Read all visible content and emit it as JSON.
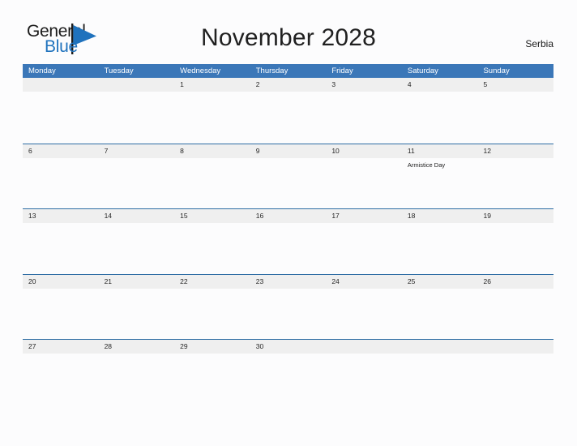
{
  "brand": {
    "name_part1": "General",
    "name_part2": "Blue",
    "flag_icon": "blue-triangle-flag-icon",
    "accent_color": "#1f72bd"
  },
  "header": {
    "title": "November 2028",
    "region": "Serbia"
  },
  "calendar": {
    "colors": {
      "header_blue": "#3b77b8",
      "row_rule_blue": "#2e6da4",
      "day_band_gray": "#efefef",
      "page_background": "#fcfcfd"
    },
    "weekdays": [
      "Monday",
      "Tuesday",
      "Wednesday",
      "Thursday",
      "Friday",
      "Saturday",
      "Sunday"
    ],
    "weeks": [
      {
        "days": [
          {
            "number": "",
            "events": []
          },
          {
            "number": "",
            "events": []
          },
          {
            "number": "1",
            "events": []
          },
          {
            "number": "2",
            "events": []
          },
          {
            "number": "3",
            "events": []
          },
          {
            "number": "4",
            "events": []
          },
          {
            "number": "5",
            "events": []
          }
        ]
      },
      {
        "days": [
          {
            "number": "6",
            "events": []
          },
          {
            "number": "7",
            "events": []
          },
          {
            "number": "8",
            "events": []
          },
          {
            "number": "9",
            "events": []
          },
          {
            "number": "10",
            "events": []
          },
          {
            "number": "11",
            "events": [
              "Armistice Day"
            ]
          },
          {
            "number": "12",
            "events": []
          }
        ]
      },
      {
        "days": [
          {
            "number": "13",
            "events": []
          },
          {
            "number": "14",
            "events": []
          },
          {
            "number": "15",
            "events": []
          },
          {
            "number": "16",
            "events": []
          },
          {
            "number": "17",
            "events": []
          },
          {
            "number": "18",
            "events": []
          },
          {
            "number": "19",
            "events": []
          }
        ]
      },
      {
        "days": [
          {
            "number": "20",
            "events": []
          },
          {
            "number": "21",
            "events": []
          },
          {
            "number": "22",
            "events": []
          },
          {
            "number": "23",
            "events": []
          },
          {
            "number": "24",
            "events": []
          },
          {
            "number": "25",
            "events": []
          },
          {
            "number": "26",
            "events": []
          }
        ]
      },
      {
        "days": [
          {
            "number": "27",
            "events": []
          },
          {
            "number": "28",
            "events": []
          },
          {
            "number": "29",
            "events": []
          },
          {
            "number": "30",
            "events": []
          },
          {
            "number": "",
            "events": []
          },
          {
            "number": "",
            "events": []
          },
          {
            "number": "",
            "events": []
          }
        ]
      }
    ]
  }
}
